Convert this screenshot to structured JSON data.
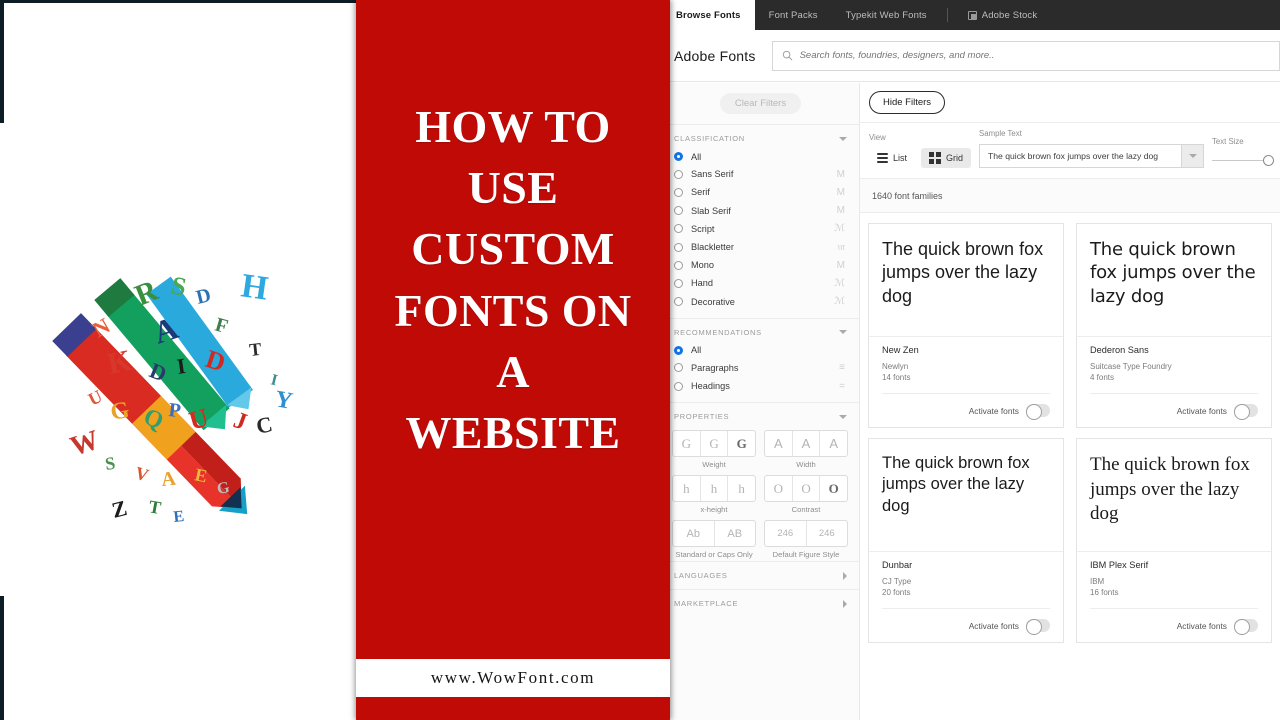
{
  "thumbnail": {
    "title_lines": [
      "HOW TO",
      "USE",
      "CUSTOM",
      "FONTS ON",
      "A",
      "WEBSITE"
    ],
    "url": "www.WowFont.com",
    "accent_red": "#C00A06",
    "illustration": "colorful-pencil-with-letters"
  },
  "app": {
    "tabs": [
      {
        "label": "Browse Fonts",
        "active": true
      },
      {
        "label": "Font Packs",
        "active": false
      },
      {
        "label": "Typekit Web Fonts",
        "active": false
      },
      {
        "label": "Adobe Stock",
        "active": false,
        "icon": "adobe-stock-icon"
      }
    ],
    "brand": "Adobe Fonts",
    "search": {
      "value": "",
      "placeholder": "Search fonts, foundries, designers, and more.."
    },
    "sidebar": {
      "clear_filters": "Clear Filters",
      "sections": [
        {
          "title": "CLASSIFICATION",
          "expanded": true,
          "options": [
            {
              "label": "All",
              "selected": true,
              "glyph": ""
            },
            {
              "label": "Sans Serif",
              "selected": false,
              "glyph": "M"
            },
            {
              "label": "Serif",
              "selected": false,
              "glyph": "M"
            },
            {
              "label": "Slab Serif",
              "selected": false,
              "glyph": "M"
            },
            {
              "label": "Script",
              "selected": false,
              "glyph": "ℳ"
            },
            {
              "label": "Blackletter",
              "selected": false,
              "glyph": "𝔪"
            },
            {
              "label": "Mono",
              "selected": false,
              "glyph": "M"
            },
            {
              "label": "Hand",
              "selected": false,
              "glyph": "ℳ"
            },
            {
              "label": "Decorative",
              "selected": false,
              "glyph": "ℳ"
            }
          ]
        },
        {
          "title": "RECOMMENDATIONS",
          "expanded": true,
          "options": [
            {
              "label": "All",
              "selected": true,
              "glyph": ""
            },
            {
              "label": "Paragraphs",
              "selected": false,
              "glyph": "≡"
            },
            {
              "label": "Headings",
              "selected": false,
              "glyph": "="
            }
          ]
        }
      ],
      "properties": {
        "title": "PROPERTIES",
        "expanded": true,
        "groups": [
          {
            "caption": "Weight",
            "cells": [
              "G",
              "G",
              "G"
            ],
            "bold_index": 2,
            "style": "serif"
          },
          {
            "caption": "Width",
            "cells": [
              "A",
              "A",
              "A"
            ],
            "bold_index": -1,
            "style": "sans"
          },
          {
            "caption": "x-height",
            "cells": [
              "h",
              "h",
              "h"
            ],
            "bold_index": -1,
            "style": "serif"
          },
          {
            "caption": "Contrast",
            "cells": [
              "O",
              "O",
              "O"
            ],
            "bold_index": 2,
            "style": "serif"
          },
          {
            "caption": "Standard or Caps Only",
            "cells": [
              "Ab",
              "AB"
            ],
            "bold_index": -1,
            "style": "sans"
          },
          {
            "caption": "Default Figure Style",
            "cells": [
              "246",
              "246"
            ],
            "bold_index": -1,
            "style": "num"
          }
        ]
      },
      "nav_sections": [
        {
          "label": "LANGUAGES"
        },
        {
          "label": "MARKETPLACE"
        }
      ]
    },
    "toolbar": {
      "hide_filters": "Hide Filters",
      "view_label": "View",
      "view_options": [
        {
          "label": "List",
          "selected": false,
          "icon": "list-view-icon"
        },
        {
          "label": "Grid",
          "selected": true,
          "icon": "grid-view-icon"
        }
      ],
      "sample_text_label": "Sample Text",
      "sample_text_value": "The quick brown fox jumps over the lazy dog",
      "text_size_label": "Text Size",
      "text_size_percent": 100
    },
    "results_count": "1640 font families",
    "cards": [
      {
        "sample": "The quick brown fox jumps over the lazy dog",
        "name": "New Zen",
        "foundry": "Newlyn",
        "fonts": "14 fonts",
        "activate_label": "Activate fonts",
        "activated": false,
        "style": "s-sans"
      },
      {
        "sample": "The quick brown fox jumps over the lazy dog",
        "name": "Dederon Sans",
        "foundry": "Suitcase Type Foundry",
        "fonts": "4 fonts",
        "activate_label": "Activate fonts",
        "activated": false,
        "style": "s-sans2"
      },
      {
        "sample": "The quick brown fox jumps over the lazy dog",
        "name": "Dunbar",
        "foundry": "CJ Type",
        "fonts": "20 fonts",
        "activate_label": "Activate fonts",
        "activated": false,
        "style": "s-cond"
      },
      {
        "sample": "The quick brown fox jumps over the lazy dog",
        "name": "IBM Plex Serif",
        "foundry": "IBM",
        "fonts": "16 fonts",
        "activate_label": "Activate fonts",
        "activated": false,
        "style": "s-serif"
      }
    ]
  }
}
